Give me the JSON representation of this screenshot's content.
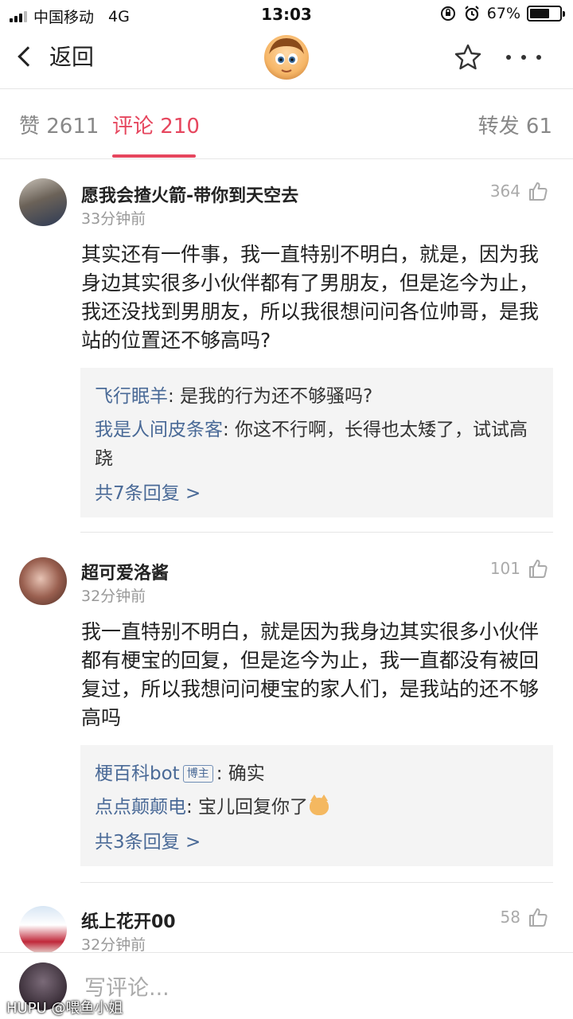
{
  "status_bar": {
    "carrier": "中国移动",
    "network": "4G",
    "time": "13:03",
    "battery": "67%",
    "battery_level": 0.67
  },
  "nav": {
    "back_label": "返回"
  },
  "tabs": [
    {
      "label": "赞 2611",
      "active": false
    },
    {
      "label": "评论 210",
      "active": true
    },
    {
      "label": "转发 61",
      "active": false
    }
  ],
  "comments": [
    {
      "author": "愿我会揸火箭-带你到天空去",
      "time": "33分钟前",
      "likes": "364",
      "body": "其实还有一件事，我一直特别不明白，就是，因为我身边其实很多小伙伴都有了男朋友，但是迄今为止，我还没找到男朋友，所以我很想问问各位帅哥，是我站的位置还不够高吗?",
      "replies": [
        {
          "author": "飞行眠羊",
          "text": ": 是我的行为还不够骚吗?"
        },
        {
          "author": "我是人间皮条客",
          "text": ": 你这不行啊，长得也太矮了，试试高跷"
        }
      ],
      "more": "共7条回复 >"
    },
    {
      "author": "超可爱洛酱",
      "time": "32分钟前",
      "likes": "101",
      "body": "我一直特别不明白，就是因为我身边其实很多小伙伴都有梗宝的回复，但是迄今为止，我一直都没有被回复过，所以我想问问梗宝的家人们，是我站的还不够高吗",
      "replies": [
        {
          "author": "梗百科bot",
          "badge": "博主",
          "text": ": 确实"
        },
        {
          "author": "点点颠颠电",
          "text": ": 宝儿回复你了",
          "emoji": "cat-emoji"
        }
      ],
      "more": "共3条回复 >"
    },
    {
      "author": "纸上花开00",
      "time": "32分钟前",
      "likes": "58"
    }
  ],
  "input": {
    "placeholder": "写评论..."
  },
  "watermark": "HUPU @喂鱼小姐"
}
